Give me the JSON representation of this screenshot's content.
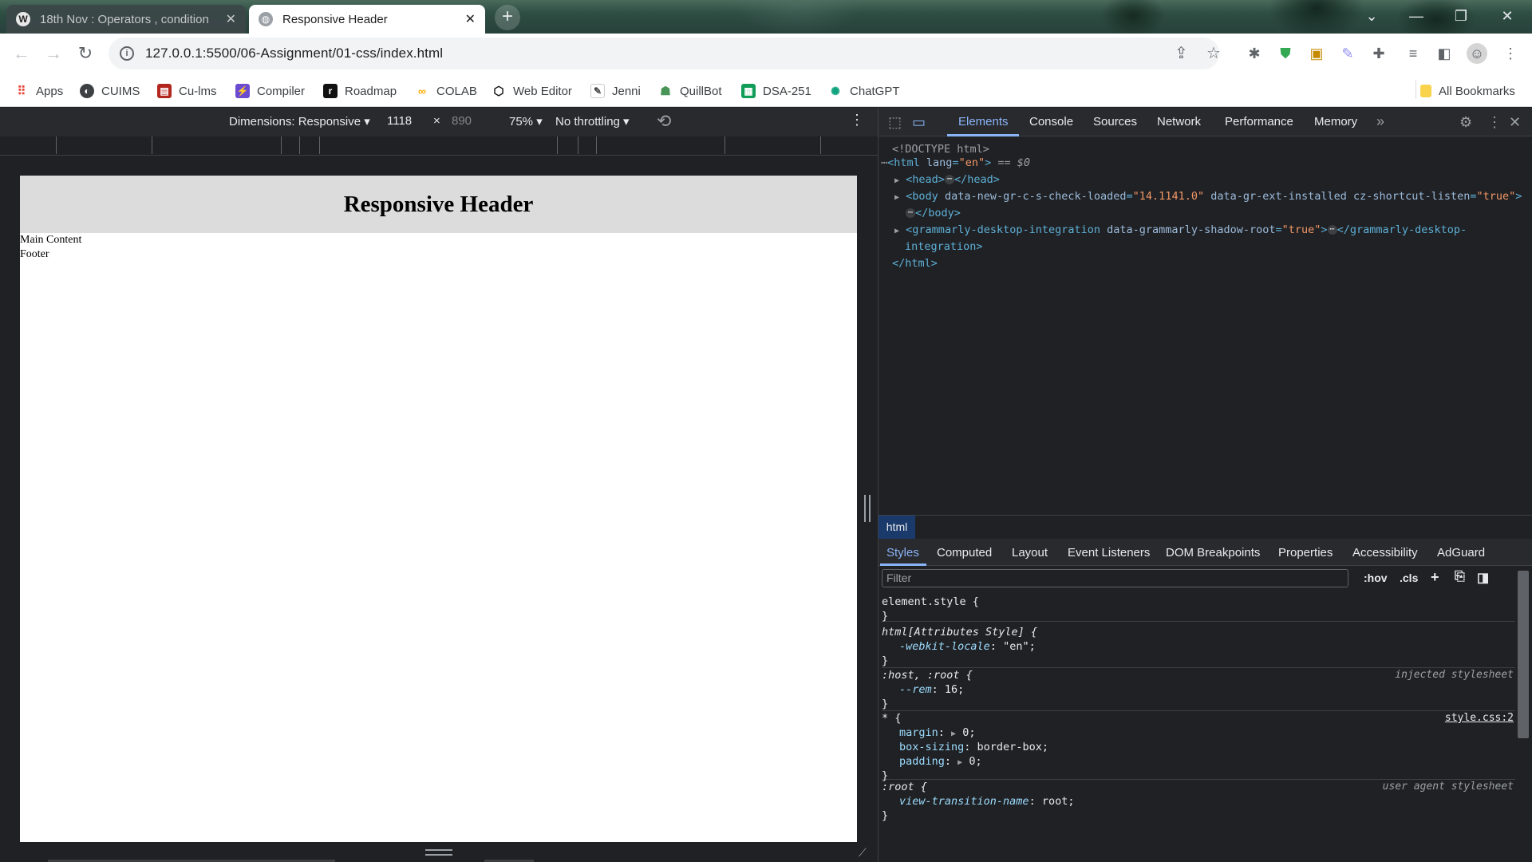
{
  "browser": {
    "tabs": [
      {
        "title": "18th Nov : Operators , condition",
        "favicon": "W"
      },
      {
        "title": "Responsive Header"
      }
    ],
    "new_tab": "+",
    "url": "127.0.0.1:5500/06-Assignment/01-css/index.html"
  },
  "bookmarks": [
    {
      "label": "Apps",
      "icon": "apps-grid-icon"
    },
    {
      "label": "CUIMS",
      "icon": "cuims-icon"
    },
    {
      "label": "Cu-lms",
      "icon": "culms-icon"
    },
    {
      "label": "Compiler",
      "icon": "compiler-icon"
    },
    {
      "label": "Roadmap",
      "icon": "roadmap-icon"
    },
    {
      "label": "COLAB",
      "icon": "colab-icon"
    },
    {
      "label": "Web Editor",
      "icon": "codepen-icon"
    },
    {
      "label": "Jenni",
      "icon": "jenni-icon"
    },
    {
      "label": "QuillBot",
      "icon": "quillbot-icon"
    },
    {
      "label": "DSA-251",
      "icon": "sheets-icon"
    },
    {
      "label": "ChatGPT",
      "icon": "chatgpt-icon"
    },
    {
      "label": "All Bookmarks",
      "icon": "folder-icon"
    }
  ],
  "device_toolbar": {
    "dimensions": "Dimensions: Responsive",
    "width": "1118",
    "times": "×",
    "height": "890",
    "zoom": "75%",
    "throttling": "No throttling"
  },
  "emulated_page": {
    "header": "Responsive Header",
    "main": "Main Content",
    "footer": "Footer"
  },
  "devtools": {
    "tabs": [
      "Elements",
      "Console",
      "Sources",
      "Network",
      "Performance",
      "Memory"
    ],
    "active_tab": "Elements",
    "dom": {
      "doctype": "<!DOCTYPE html>",
      "html_open_tag": "<html",
      "html_attr": "lang",
      "html_val": "\"en\"",
      "html_close": ">",
      "selected_marker": "== $0",
      "head_open": "<head>",
      "head_close": "</head>",
      "body_open": "<body",
      "body_attr1": "data-new-gr-c-s-check-loaded",
      "body_val1": "\"14.1141.0\"",
      "body_attr2": "data-gr-ext-installed",
      "body_attr3": "cz-shortcut-listen",
      "body_val3": "\"true\"",
      "body_close": "</body>",
      "gram_open": "<grammarly-desktop-integration",
      "gram_attr": "data-grammarly-shadow-root",
      "gram_val": "\"true\"",
      "gram_close1": "</grammarly-desktop-",
      "gram_close2": "integration>",
      "html_end": "</html>"
    },
    "breadcrumb": "html",
    "sub_tabs": [
      "Styles",
      "Computed",
      "Layout",
      "Event Listeners",
      "DOM Breakpoints",
      "Properties",
      "Accessibility",
      "AdGuard"
    ],
    "active_sub_tab": "Styles",
    "filter_placeholder": "Filter",
    "hov": ":hov",
    "cls": ".cls",
    "rules": {
      "element_style": "element.style {",
      "html_attr_selector": "html[Attributes Style] {",
      "locale_prop": "-webkit-locale",
      "locale_val": "\"en\";",
      "host_root": ":host, :root {",
      "host_src": "injected stylesheet",
      "rem_prop": "--rem",
      "rem_val": "16;",
      "star": "* {",
      "star_src": "style.css:2",
      "margin_prop": "margin",
      "margin_val": "0;",
      "boxsizing_prop": "box-sizing",
      "boxsizing_val": "border-box;",
      "padding_prop": "padding",
      "padding_val": "0;",
      "root": ":root {",
      "root_src": "user agent stylesheet",
      "vt_prop": "view-transition-name",
      "vt_val": "root;",
      "close": "}"
    }
  }
}
